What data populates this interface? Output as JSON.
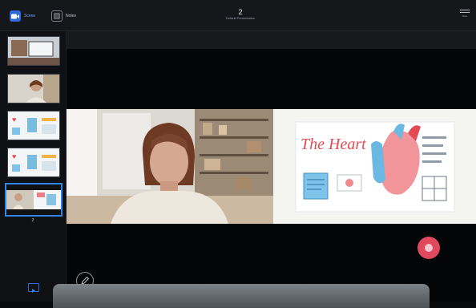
{
  "topbar": {
    "tabs": [
      {
        "label": "Scene",
        "icon": "camera-icon"
      },
      {
        "label": "Notes",
        "icon": "notes-icon"
      }
    ],
    "title_number": "2",
    "title_name": "Default Presentation",
    "menu_caption": "Slide",
    "menu_icon": "menu-icon"
  },
  "sidebar": {
    "slides": [
      {
        "number": "",
        "kind": "desktop-scene",
        "active": false
      },
      {
        "number": "",
        "kind": "presenter-video",
        "active": false
      },
      {
        "number": "",
        "kind": "heart-slide",
        "active": false
      },
      {
        "number": "",
        "kind": "heart-slide",
        "active": false
      },
      {
        "number": "2",
        "kind": "split-scene",
        "active": true
      }
    ],
    "bottom_icon": "scene-icon"
  },
  "stage": {
    "slide_title": "The Heart",
    "record_icon": "record-icon",
    "pen_icon": "pen-icon"
  },
  "colors": {
    "accent": "#2f86ea",
    "record": "#e0485e",
    "background": "#090a0c"
  }
}
